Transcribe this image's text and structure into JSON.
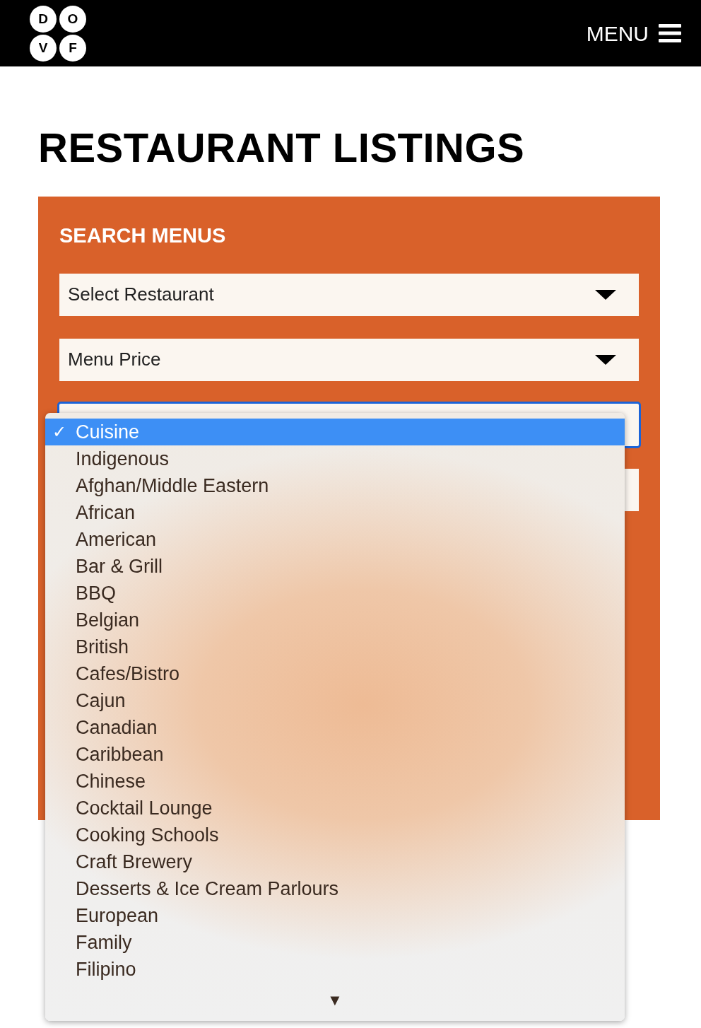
{
  "header": {
    "logo_letters": [
      "D",
      "O",
      "V",
      "F"
    ],
    "menu_label": "MENU"
  },
  "page_title": "RESTAURANT LISTINGS",
  "search_panel": {
    "title": "SEARCH MENUS",
    "selects": [
      {
        "value": "Select Restaurant",
        "focused": false
      },
      {
        "value": "Menu Price",
        "focused": false
      },
      {
        "focused": true
      },
      {
        "focused": false
      }
    ]
  },
  "dropdown": {
    "options": [
      {
        "label": "Cuisine",
        "selected": true
      },
      {
        "label": "Indigenous",
        "selected": false
      },
      {
        "label": "Afghan/Middle Eastern",
        "selected": false
      },
      {
        "label": "African",
        "selected": false
      },
      {
        "label": "American",
        "selected": false
      },
      {
        "label": "Bar & Grill",
        "selected": false
      },
      {
        "label": "BBQ",
        "selected": false
      },
      {
        "label": "Belgian",
        "selected": false
      },
      {
        "label": "British",
        "selected": false
      },
      {
        "label": "Cafes/Bistro",
        "selected": false
      },
      {
        "label": "Cajun",
        "selected": false
      },
      {
        "label": "Canadian",
        "selected": false
      },
      {
        "label": "Caribbean",
        "selected": false
      },
      {
        "label": "Chinese",
        "selected": false
      },
      {
        "label": "Cocktail Lounge",
        "selected": false
      },
      {
        "label": "Cooking Schools",
        "selected": false
      },
      {
        "label": "Craft Brewery",
        "selected": false
      },
      {
        "label": "Desserts & Ice Cream Parlours",
        "selected": false
      },
      {
        "label": "European",
        "selected": false
      },
      {
        "label": "Family",
        "selected": false
      },
      {
        "label": "Filipino",
        "selected": false
      }
    ],
    "check_mark": "✓",
    "scroll_arrow": "▼"
  }
}
